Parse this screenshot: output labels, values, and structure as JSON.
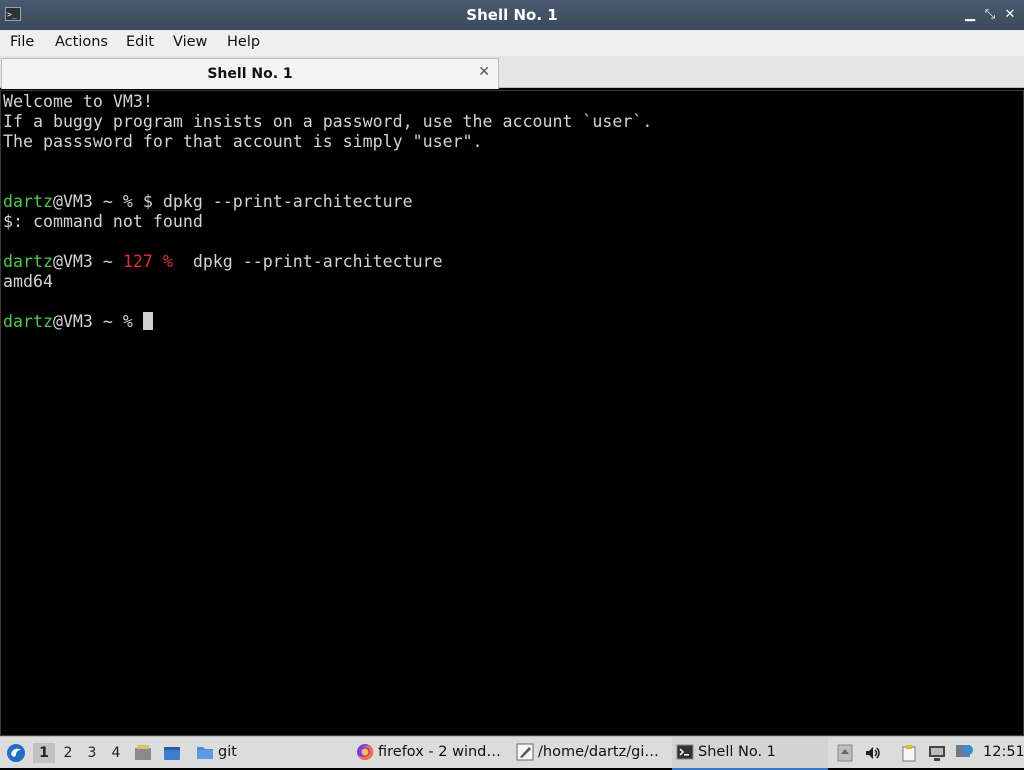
{
  "window": {
    "title": "Shell No. 1",
    "buttons": {
      "minimize": "▁",
      "restore": "⤡",
      "close": "✕"
    }
  },
  "menubar": [
    "File",
    "Actions",
    "Edit",
    "View",
    "Help"
  ],
  "tabs": [
    {
      "label": "Shell No. 1",
      "close": "✕"
    }
  ],
  "terminal": {
    "lines": [
      {
        "segments": [
          {
            "text": "Welcome to VM3!"
          }
        ]
      },
      {
        "segments": [
          {
            "text": "If a buggy program insists on a password, use the account `user`."
          }
        ]
      },
      {
        "segments": [
          {
            "text": "The passsword for that account is simply \"user\"."
          }
        ]
      },
      {
        "segments": [
          {
            "text": ""
          }
        ]
      },
      {
        "segments": [
          {
            "text": ""
          }
        ]
      },
      {
        "segments": [
          {
            "text": "dartz",
            "color": "green"
          },
          {
            "text": "@VM3 ~ % $ dpkg --print-architecture"
          }
        ]
      },
      {
        "segments": [
          {
            "text": "$: command not found"
          }
        ]
      },
      {
        "segments": [
          {
            "text": ""
          }
        ]
      },
      {
        "segments": [
          {
            "text": "dartz",
            "color": "green"
          },
          {
            "text": "@VM3 ~ "
          },
          {
            "text": "127 %",
            "color": "red"
          },
          {
            "text": "  dpkg --print-architecture"
          }
        ]
      },
      {
        "segments": [
          {
            "text": "amd64"
          }
        ]
      },
      {
        "segments": [
          {
            "text": ""
          }
        ]
      },
      {
        "segments": [
          {
            "text": "dartz",
            "color": "green"
          },
          {
            "text": "@VM3 ~ % "
          }
        ],
        "cursor": true
      }
    ]
  },
  "taskbar": {
    "workspaces": [
      "1",
      "2",
      "3",
      "4"
    ],
    "active_workspace": "1",
    "quicklaunch": [
      {
        "label": "git",
        "icon": "folder-icon"
      }
    ],
    "tasks": [
      {
        "label": "firefox - 2 wind…",
        "icon": "firefox-icon"
      },
      {
        "label": "/home/dartz/gi…",
        "icon": "text-editor-icon"
      },
      {
        "label": "Shell No. 1",
        "icon": "terminal-icon",
        "active": true
      }
    ],
    "clock": "12:51"
  },
  "colors": {
    "prompt_user": "#4ec94e",
    "error_code": "#e0303a",
    "terminal_bg": "#000000",
    "terminal_fg": "#d3d3d3",
    "taskbar_accent": "#3875c2"
  }
}
